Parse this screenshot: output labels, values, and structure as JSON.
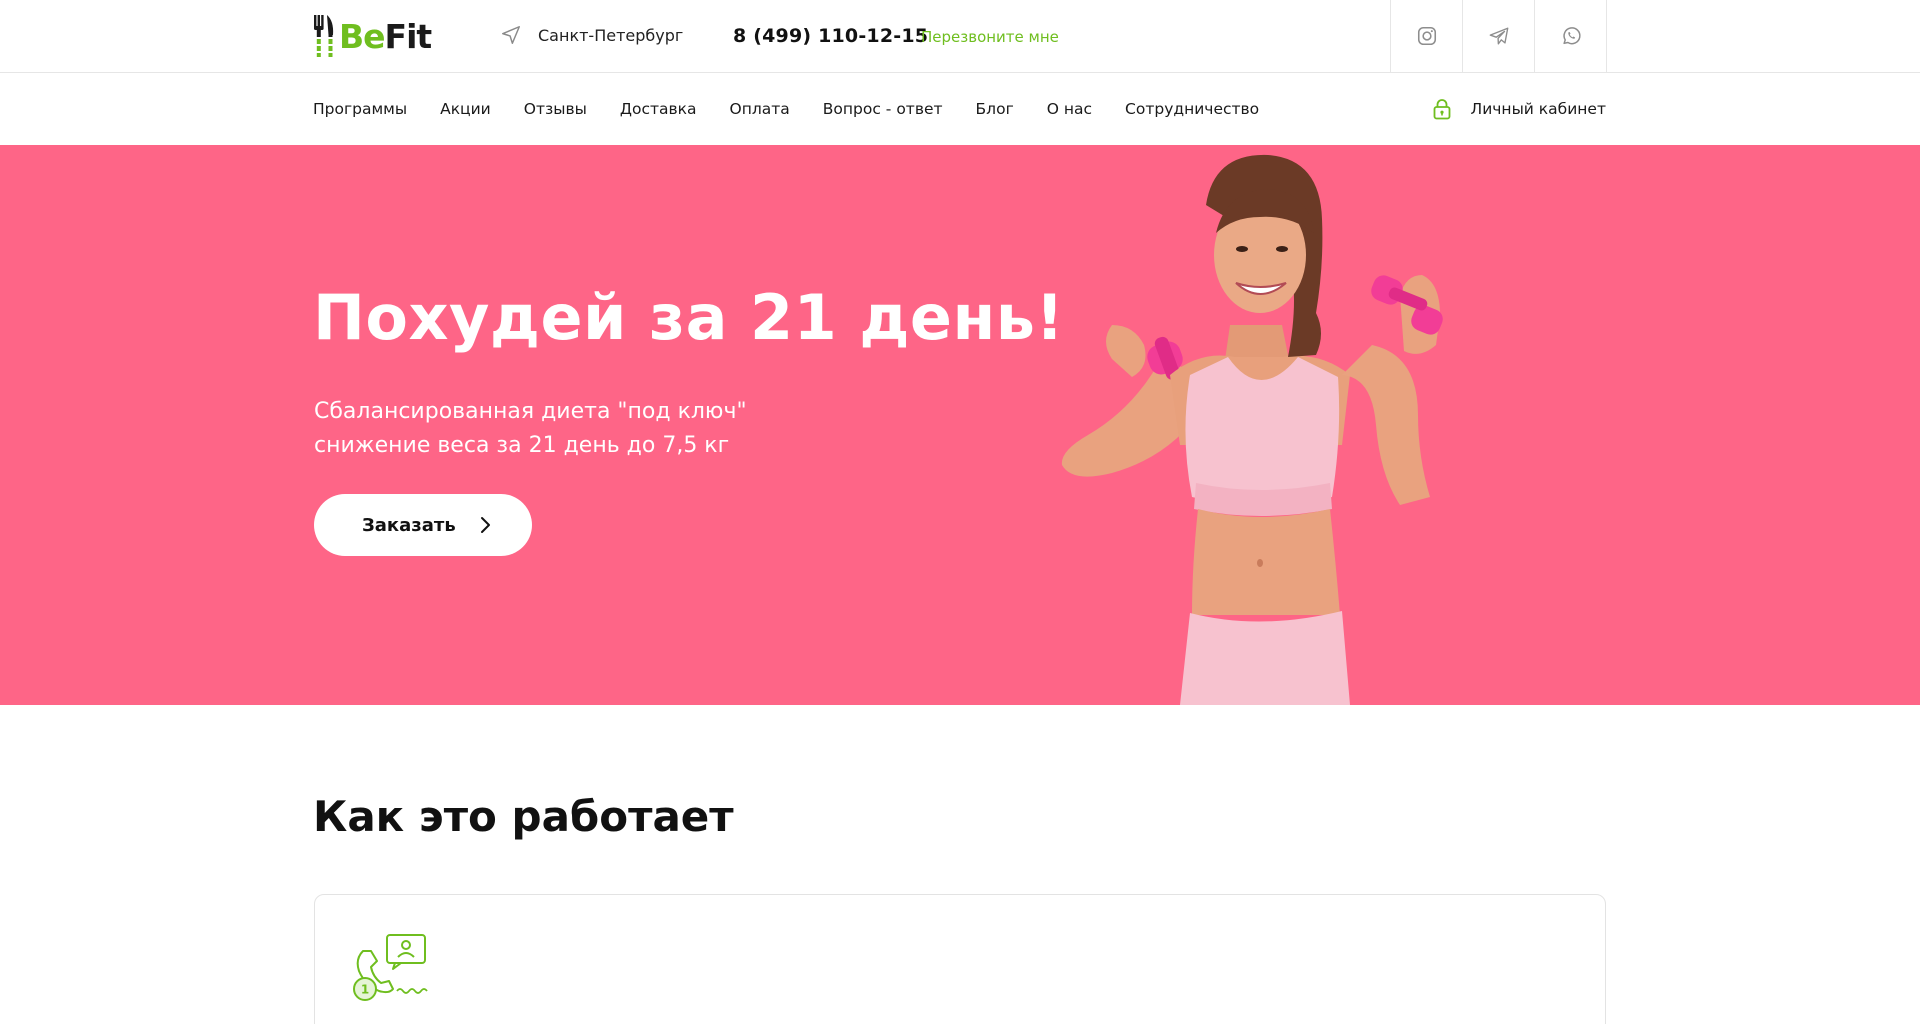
{
  "brand": {
    "logo_be": "Be",
    "logo_fit": "Fit",
    "accent": "#6fbe1f",
    "hero_color": "#fe6587"
  },
  "header": {
    "city": "Санкт-Петербург",
    "phone": "8 (499) 110-12-15",
    "callback": "Перезвоните мне",
    "socials": [
      {
        "icon": "instagram-icon"
      },
      {
        "icon": "telegram-icon"
      },
      {
        "icon": "whatsapp-icon"
      }
    ]
  },
  "nav": {
    "items": [
      "Программы",
      "Акции",
      "Отзывы",
      "Доставка",
      "Оплата",
      "Вопрос - ответ",
      "Блог",
      "О нас",
      "Сотрудничество"
    ],
    "account": "Личный кабинет"
  },
  "hero": {
    "title": "Похудей за 21 день!",
    "subtitle_line1": "Сбалансированная диета \"под ключ\"",
    "subtitle_line2": "снижение веса за 21 день до 7,5 кг",
    "button": "Заказать"
  },
  "how_it_works": {
    "title": "Как это работает",
    "steps": [
      {
        "number": "1",
        "icon": "consultation-icon"
      }
    ]
  }
}
